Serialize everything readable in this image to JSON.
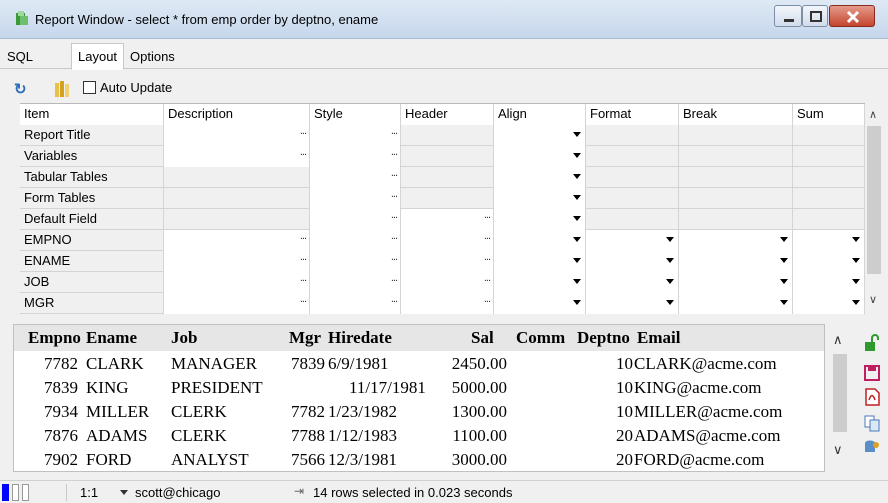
{
  "window": {
    "title": "Report Window - select * from emp order by deptno, ename"
  },
  "tabs": [
    "SQL",
    "Layout",
    "Options"
  ],
  "toolbar": {
    "auto_update_label": "Auto Update"
  },
  "grid": {
    "columns": [
      "Item",
      "Description",
      "Style",
      "Header",
      "Align",
      "Format",
      "Break",
      "Sum"
    ],
    "rows": [
      {
        "checked": true,
        "item": "Report Title"
      },
      {
        "checked": true,
        "item": "Variables"
      },
      {
        "checked": false,
        "item": "Tabular Tables"
      },
      {
        "checked": false,
        "item": "Form Tables"
      },
      {
        "checked": false,
        "item": "Default Field"
      },
      {
        "checked": true,
        "item": "EMPNO"
      },
      {
        "checked": true,
        "item": "ENAME"
      },
      {
        "checked": true,
        "item": "JOB"
      },
      {
        "checked": true,
        "item": "MGR"
      }
    ]
  },
  "results": {
    "columns": [
      "Empno",
      "Ename",
      "Job",
      "Mgr",
      "Hiredate",
      "Sal",
      "Comm",
      "Deptno",
      "Email"
    ],
    "rows": [
      [
        "7782",
        "CLARK",
        "MANAGER",
        "7839",
        "6/9/1981",
        "2450.00",
        "",
        "10",
        "CLARK@acme.com"
      ],
      [
        "7839",
        "KING",
        "PRESIDENT",
        "",
        "11/17/1981",
        "5000.00",
        "",
        "10",
        "KING@acme.com"
      ],
      [
        "7934",
        "MILLER",
        "CLERK",
        "7782",
        "1/23/1982",
        "1300.00",
        "",
        "10",
        "MILLER@acme.com"
      ],
      [
        "7876",
        "ADAMS",
        "CLERK",
        "7788",
        "1/12/1983",
        "1100.00",
        "",
        "20",
        "ADAMS@acme.com"
      ],
      [
        "7902",
        "FORD",
        "ANALYST",
        "7566",
        "12/3/1981",
        "3000.00",
        "",
        "20",
        "FORD@acme.com"
      ]
    ]
  },
  "status": {
    "position": "1:1",
    "connection": "scott@chicago",
    "message": "14 rows selected in 0.023 seconds"
  },
  "colors": {
    "accent": "#0000ff",
    "title_bar": "#c6d7ec",
    "close_button": "#c4462f"
  }
}
